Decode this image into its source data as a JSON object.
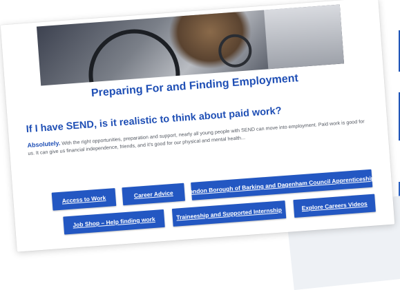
{
  "page": {
    "title": "Preparing For and Finding Employment"
  },
  "faq": {
    "question": "If I have SEND, is it realistic to think about paid work?",
    "answer_lead": "Absolutely.",
    "answer_text": " With the right opportunities, preparation and support, nearly all young people with SEND can move into employment. Paid work is good for us. It can give us financial independence, friends, and it's good for our physical and mental health..."
  },
  "buttons": [
    {
      "label": "Access to Work"
    },
    {
      "label": "Career Advice"
    },
    {
      "label": "London Borough of Barking and Dagenham Council Apprenticeships"
    },
    {
      "label": "Job Shop – Help finding work"
    },
    {
      "label": "Traineeship and Supported Internship"
    },
    {
      "label": "Explore Careers Videos"
    }
  ],
  "colors": {
    "accent": "#1f4fb5",
    "button": "#2357c2"
  }
}
